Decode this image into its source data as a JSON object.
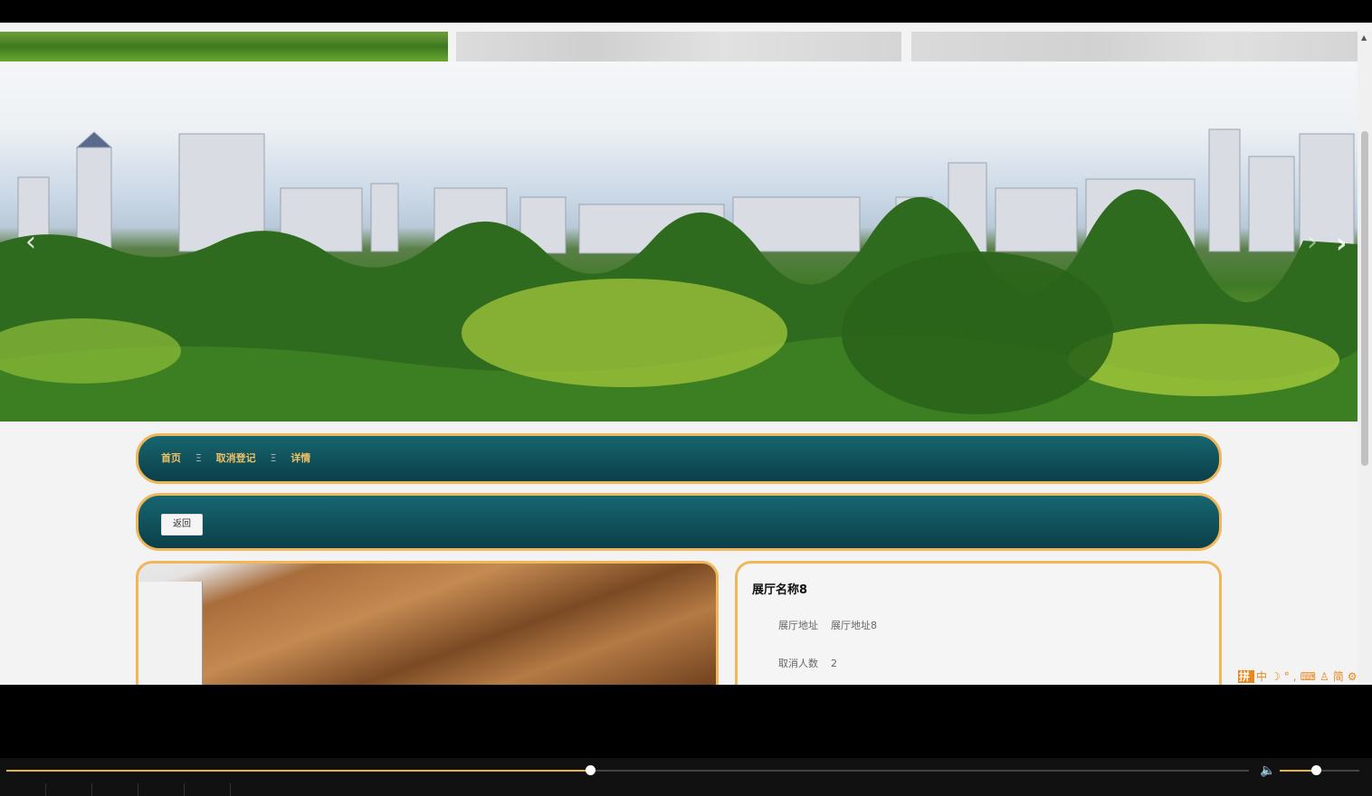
{
  "breadcrumb": {
    "home": "首页",
    "section": "取消登记",
    "current": "详情",
    "separator": "Ξ"
  },
  "toolbar": {
    "back_label": "返回"
  },
  "detail": {
    "title": "展厅名称8",
    "fields": [
      {
        "label": "展厅地址",
        "value": "展厅地址8"
      },
      {
        "label": "取消人数",
        "value": "2"
      }
    ]
  },
  "carousel": {
    "prev_icon": "chevron-left-icon",
    "next_icon": "chevron-right-icon"
  },
  "ime_toolbar": {
    "items": [
      "拼",
      "中",
      "☽",
      "°,",
      "⌨",
      "♙",
      "简",
      "⚙"
    ]
  },
  "player": {
    "progress": 0.47,
    "volume": 0.45,
    "volume_icon": "speaker-icon"
  },
  "colors": {
    "accent_border": "#f0b75a",
    "bar_teal": "#0f4f59",
    "crumb_text": "#f0c064",
    "progress": "#e3b53a"
  }
}
